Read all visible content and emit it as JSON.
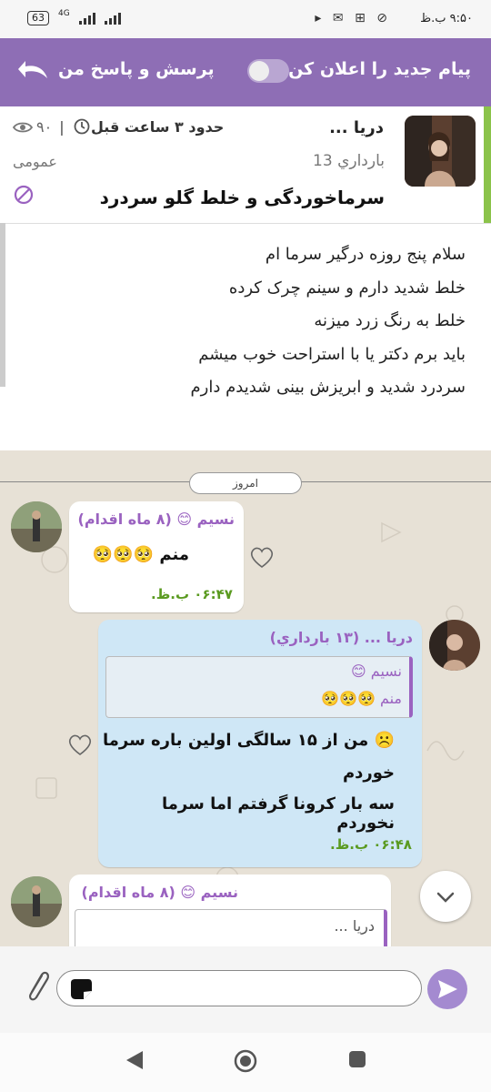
{
  "status_bar": {
    "time": "۹:۵۰ ب.ظ",
    "battery": "63",
    "network": "4G"
  },
  "toolbar": {
    "title": "پیام جدید را اعلان کن",
    "subtitle": "پرسش و پاسخ من"
  },
  "post": {
    "author": "دریا ...",
    "time_ago": "حدود ۳ ساعت قبل",
    "views": "۹۰",
    "pregnancy": "13 بارداري",
    "category": "عمومی",
    "subject": "سرماخوردگی و خلط گلو سردرد",
    "body_lines": [
      "سلام پنج روزه درگیر سرما ام",
      "خلط شدید دارم و سینم چرک کرده",
      "خلط به رنگ زرد میزنه",
      "باید برم دکتر یا با استراحت خوب میشم",
      "سردرد شدید و ابریزش بینی شدیدم دارم"
    ]
  },
  "chat": {
    "date_label": "امروز",
    "messages": [
      {
        "author": "نسیم 😊 (۸ ماه اقدام)",
        "text": "منم 🥺🥺🥺",
        "time": "۰۶:۴۷ ب.ظ."
      },
      {
        "author": "دریا ... (۱۳ بارداري)",
        "quote_author": "نسیم 😊",
        "quote_text": "منم 🥺🥺🥺",
        "text_lines": [
          "☹️ من از ۱۵ سالگی اولین باره سرما",
          "خوردم",
          "سه بار کرونا گرفتم اما سرما نخوردم"
        ],
        "time": "۰۶:۴۸ ب.ظ."
      },
      {
        "author": "نسیم 😊 (۸ ماه اقدام)",
        "quote_author": "دریا ..."
      }
    ]
  },
  "colors": {
    "toolbar": "#8e6eb5",
    "accent_name": "#9a62c0",
    "time_green": "#5a9a20",
    "outgoing_bubble": "#cfe7f6",
    "chat_bg": "#e7e1d6"
  }
}
